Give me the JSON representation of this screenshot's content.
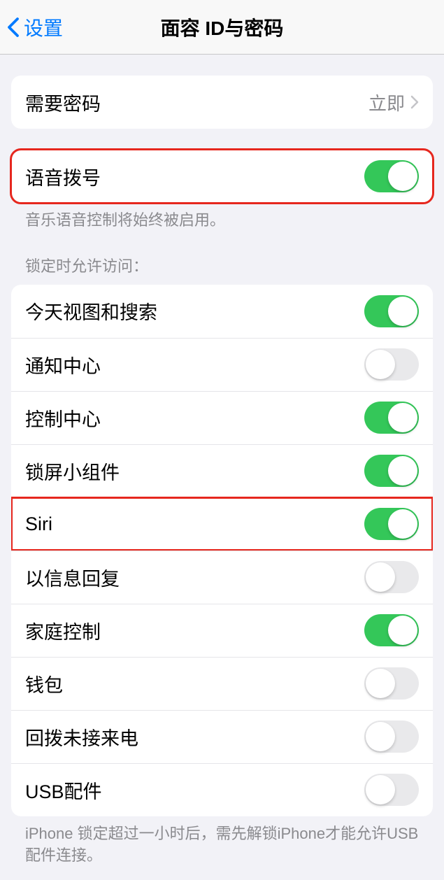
{
  "header": {
    "back_label": "设置",
    "title": "面容 ID与密码"
  },
  "require_passcode": {
    "label": "需要密码",
    "value": "立即"
  },
  "voice_dial": {
    "label": "语音拨号",
    "enabled": true,
    "footer": "音乐语音控制将始终被启用。"
  },
  "lock_screen_access": {
    "header": "锁定时允许访问：",
    "items": [
      {
        "label": "今天视图和搜索",
        "enabled": true
      },
      {
        "label": "通知中心",
        "enabled": false
      },
      {
        "label": "控制中心",
        "enabled": true
      },
      {
        "label": "锁屏小组件",
        "enabled": true
      },
      {
        "label": "Siri",
        "enabled": true,
        "highlighted": true
      },
      {
        "label": "以信息回复",
        "enabled": false
      },
      {
        "label": "家庭控制",
        "enabled": true
      },
      {
        "label": "钱包",
        "enabled": false
      },
      {
        "label": "回拨未接来电",
        "enabled": false
      },
      {
        "label": "USB配件",
        "enabled": false
      }
    ],
    "footer": "iPhone 锁定超过一小时后，需先解锁iPhone才能允许USB 配件连接。"
  }
}
